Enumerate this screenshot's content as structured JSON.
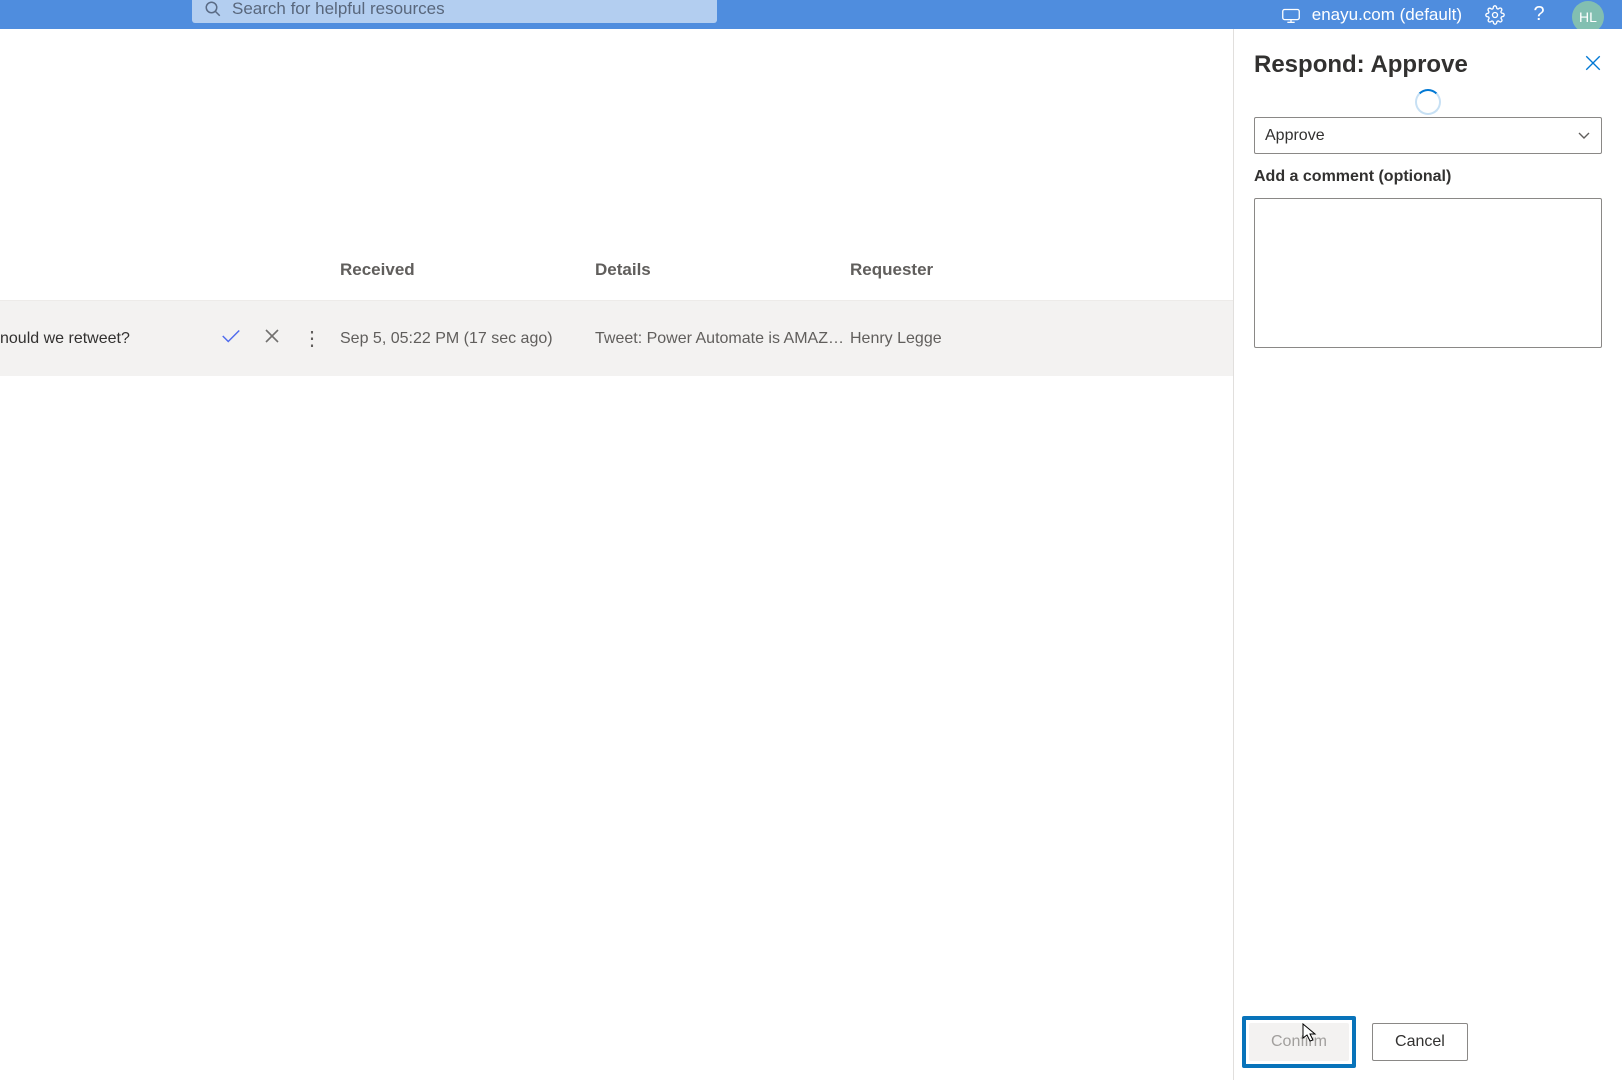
{
  "header": {
    "search_placeholder": "Search for helpful resources",
    "environment": "enayu.com (default)",
    "avatar_initials": "HL"
  },
  "table": {
    "columns": {
      "received": "Received",
      "details": "Details",
      "requester": "Requester"
    },
    "rows": [
      {
        "title": "nould we retweet?",
        "received": "Sep 5, 05:22 PM (17 sec ago)",
        "details": "Tweet: Power Automate is AMAZEBA...",
        "requester": "Henry Legge"
      }
    ]
  },
  "panel": {
    "title": "Respond: Approve",
    "dropdown_value": "Approve",
    "comment_label": "Add a comment (optional)",
    "comment_value": "",
    "confirm_label": "Confirm",
    "cancel_label": "Cancel"
  }
}
